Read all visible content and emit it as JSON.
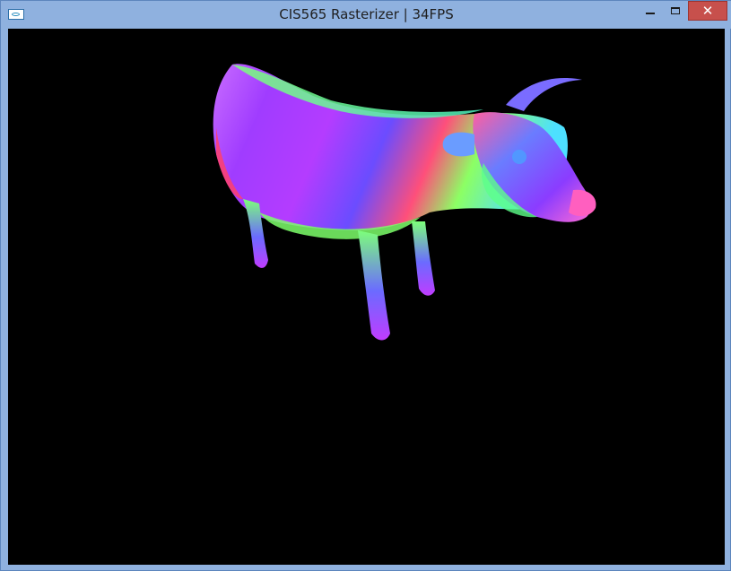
{
  "window": {
    "title": "CIS565 Rasterizer | 34FPS",
    "icon": "app-icon",
    "controls": {
      "minimize_icon": "minimize-icon",
      "maximize_icon": "maximize-icon",
      "close_icon": "close-icon"
    }
  },
  "viewport": {
    "background": "#000000",
    "scene": "cow-model-normals-shading"
  },
  "colors": {
    "titlebar": "#8fb1df",
    "close_button": "#c7504c"
  }
}
